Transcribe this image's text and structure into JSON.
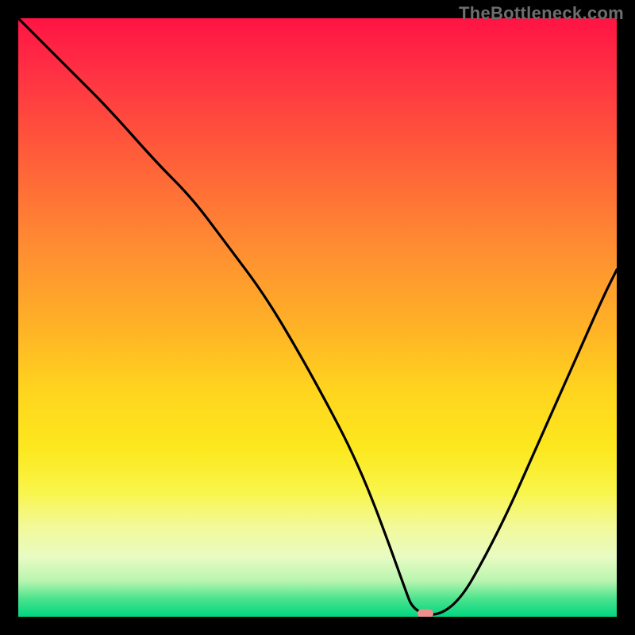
{
  "watermark": "TheBottleneck.com",
  "colors": {
    "page_bg": "#000000",
    "grad_top": "#ff1444",
    "grad_bottom": "#00d680",
    "stroke": "#000000",
    "marker": "#ee8f8b"
  },
  "chart_data": {
    "type": "line",
    "title": "",
    "xlabel": "",
    "ylabel": "",
    "xlim": [
      0,
      100
    ],
    "ylim": [
      0,
      100
    ],
    "grid": false,
    "series": [
      {
        "name": "curve",
        "x": [
          0,
          3,
          9,
          15,
          23,
          29,
          35,
          41,
          47,
          53,
          56,
          59,
          62,
          64.5,
          66,
          70,
          74,
          78,
          82,
          86,
          90,
          94,
          98,
          100
        ],
        "values": [
          100,
          97,
          91,
          85,
          76,
          70,
          62,
          54,
          44,
          33,
          27,
          20,
          12,
          5,
          1,
          0,
          3,
          10,
          18,
          27,
          36,
          45,
          54,
          58
        ]
      }
    ],
    "marker": {
      "x": 68,
      "y": 0.5
    }
  }
}
